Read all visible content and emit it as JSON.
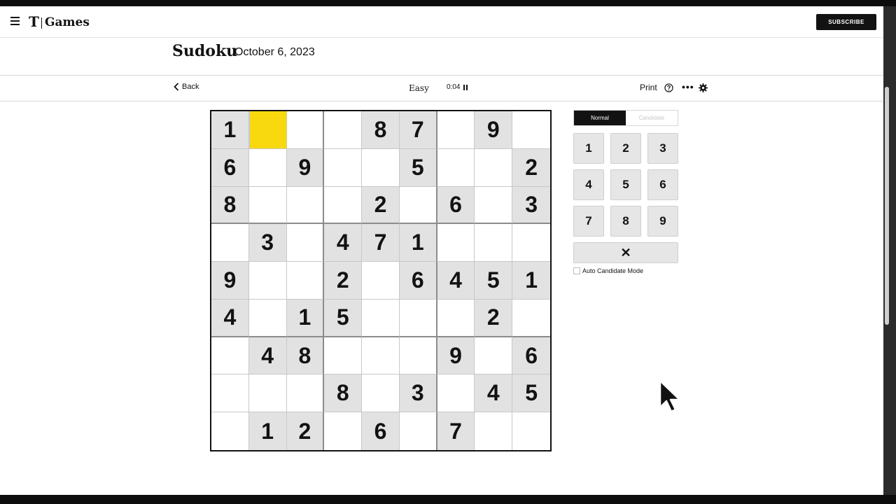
{
  "header": {
    "logo_mark": "T",
    "brand": "Games",
    "subscribe_label": "SUBSCRIBE"
  },
  "title": {
    "game": "Sudoku",
    "date": "October 6, 2023"
  },
  "toolbar": {
    "back_label": "Back",
    "difficulty": "Easy",
    "timer": "0:04",
    "print_label": "Print",
    "more_label": "•••"
  },
  "board": {
    "cells": [
      [
        "1",
        "",
        "",
        "",
        "8",
        "7",
        "",
        "9",
        ""
      ],
      [
        "6",
        "",
        "9",
        "",
        "",
        "5",
        "",
        "",
        "2"
      ],
      [
        "8",
        "",
        "",
        "",
        "2",
        "",
        "6",
        "",
        "3"
      ],
      [
        "",
        "3",
        "",
        "4",
        "7",
        "1",
        "",
        "",
        ""
      ],
      [
        "9",
        "",
        "",
        "2",
        "",
        "6",
        "4",
        "5",
        "1"
      ],
      [
        "4",
        "",
        "1",
        "5",
        "",
        "",
        "",
        "2",
        ""
      ],
      [
        "",
        "4",
        "8",
        "",
        "",
        "",
        "9",
        "",
        "6"
      ],
      [
        "",
        "",
        "",
        "8",
        "",
        "3",
        "",
        "4",
        "5"
      ],
      [
        "",
        "1",
        "2",
        "",
        "6",
        "",
        "7",
        "",
        ""
      ]
    ],
    "selected": {
      "row": 0,
      "col": 1
    },
    "selected_color": "#f8d90f",
    "given_color": "#e2e2e2"
  },
  "controls": {
    "modes": [
      "Normal",
      "Candidate"
    ],
    "active_mode": "Normal",
    "numbers": [
      "1",
      "2",
      "3",
      "4",
      "5",
      "6",
      "7",
      "8",
      "9"
    ],
    "erase_label": "✕",
    "auto_candidate_label": "Auto Candidate Mode",
    "auto_candidate_checked": false
  },
  "icons": [
    "menu-icon",
    "chevron-left-icon",
    "pause-icon",
    "help-icon",
    "more-icon",
    "gear-icon",
    "mouse-cursor-icon"
  ]
}
